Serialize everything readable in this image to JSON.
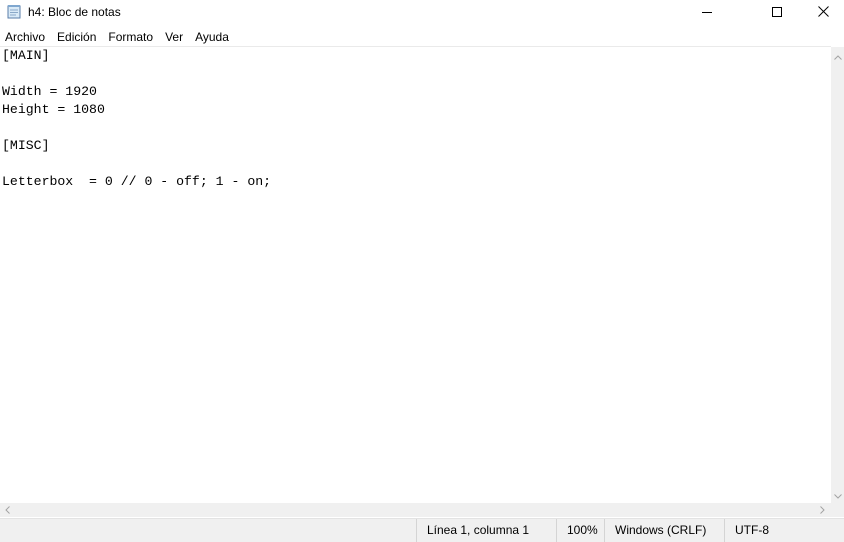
{
  "window": {
    "title": "h4: Bloc de notas",
    "icon": "notepad-icon",
    "controls": [
      "minimize-icon",
      "maximize-icon",
      "close-icon"
    ]
  },
  "menu": {
    "items": [
      "Archivo",
      "Edición",
      "Formato",
      "Ver",
      "Ayuda"
    ]
  },
  "editor": {
    "lines": [
      "[MAIN]",
      "",
      "Width = 1920",
      "Height = 1080",
      "",
      "[MISC]",
      "",
      "Letterbox  = 0 // 0 - off; 1 - on;"
    ]
  },
  "status": {
    "position": "Línea 1, columna 1",
    "zoom": "100%",
    "line_ending": "Windows (CRLF)",
    "encoding": "UTF-8"
  }
}
